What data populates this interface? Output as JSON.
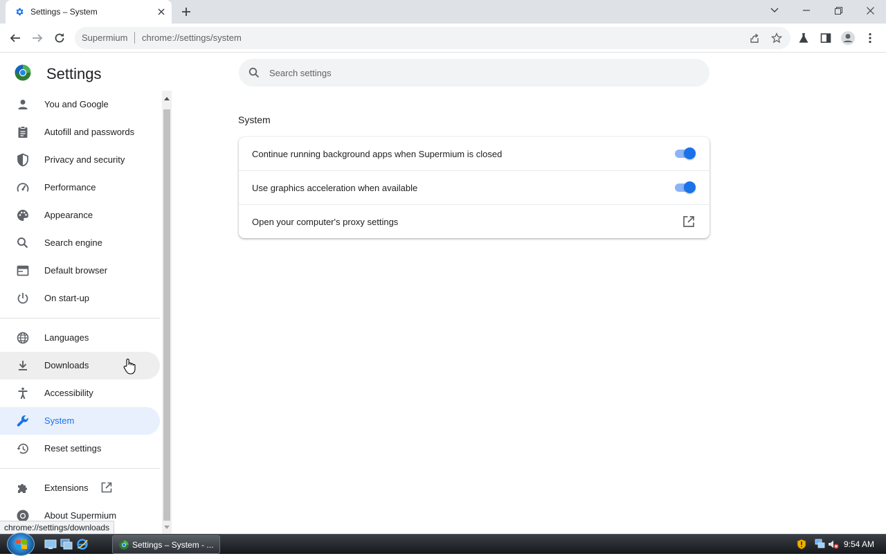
{
  "browser": {
    "tab": {
      "title": "Settings – System",
      "icon": "gear-icon"
    },
    "new_tab_icon": "plus-icon",
    "window_controls": [
      "tab-search-icon",
      "minimize-icon",
      "restore-icon",
      "close-icon"
    ],
    "toolbar": {
      "site_name": "Supermium",
      "url": "chrome://settings/system",
      "icons": [
        "back-arrow-icon",
        "forward-arrow-icon",
        "reload-icon",
        "share-icon",
        "star-icon",
        "lab-flask-icon",
        "side-panel-icon",
        "profile-icon",
        "more-vertical-icon"
      ]
    },
    "status_bubble": "chrome://settings/downloads"
  },
  "settings": {
    "title": "Settings",
    "search_placeholder": "Search settings",
    "sidebar": {
      "items": [
        {
          "label": "You and Google",
          "icon": "person-icon"
        },
        {
          "label": "Autofill and passwords",
          "icon": "clipboard-icon"
        },
        {
          "label": "Privacy and security",
          "icon": "shield-icon"
        },
        {
          "label": "Performance",
          "icon": "speedometer-icon"
        },
        {
          "label": "Appearance",
          "icon": "palette-icon"
        },
        {
          "label": "Search engine",
          "icon": "search-icon"
        },
        {
          "label": "Default browser",
          "icon": "browser-window-icon"
        },
        {
          "label": "On start-up",
          "icon": "power-icon"
        },
        {
          "label": "Languages",
          "icon": "globe-icon"
        },
        {
          "label": "Downloads",
          "icon": "download-icon"
        },
        {
          "label": "Accessibility",
          "icon": "accessibility-icon"
        },
        {
          "label": "System",
          "icon": "wrench-icon"
        },
        {
          "label": "Reset settings",
          "icon": "history-icon"
        },
        {
          "label": "Extensions",
          "icon": "puzzle-icon"
        },
        {
          "label": "About Supermium",
          "icon": "supermium-logo-icon"
        }
      ],
      "active": "System",
      "hovered": "Downloads"
    },
    "section": {
      "title": "System",
      "rows": [
        {
          "label": "Continue running background apps when Supermium is closed",
          "control": "toggle",
          "on": true
        },
        {
          "label": "Use graphics acceleration when available",
          "control": "toggle",
          "on": true
        },
        {
          "label": "Open your computer's proxy settings",
          "control": "external-link"
        }
      ]
    }
  },
  "taskbar": {
    "task_button_label": "Settings – System - ...",
    "clock": "9:54 AM",
    "quick_launch": [
      "show-desktop-icon",
      "window-switcher-icon",
      "internet-explorer-icon"
    ],
    "tray": [
      "security-shield-icon",
      "network-icon",
      "volume-muted-icon"
    ]
  },
  "colors": {
    "accent": "#1a73e8",
    "active_bg": "#e8f0fe",
    "toggle_track": "#8ab4f8",
    "tabstrip": "#dee1e6"
  }
}
